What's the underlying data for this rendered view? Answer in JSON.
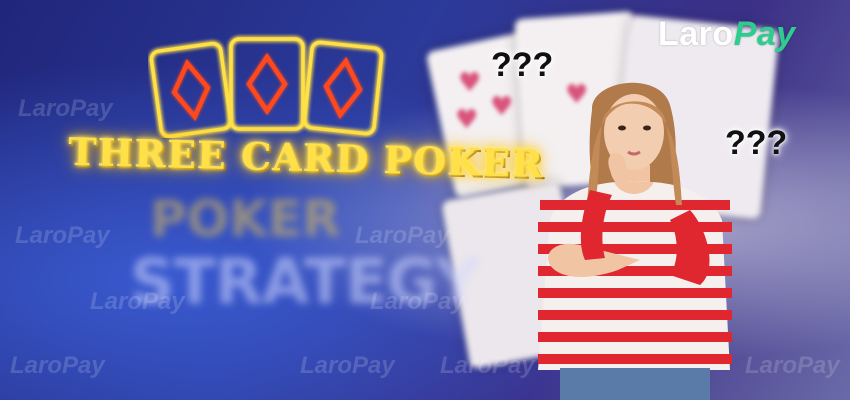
{
  "banner": {
    "title": "THREE CARD POKER",
    "background_text": {
      "top": "POKER",
      "bottom": "STRATEGY"
    },
    "question_marks": [
      "???",
      "???"
    ],
    "brand": {
      "name_part1": "Laro",
      "name_part2": "Pay",
      "watermark": "LaroPay"
    },
    "colors": {
      "neon_yellow": "#ffe046",
      "neon_red": "#ff4a1c",
      "brand_green": "#2ecc8e",
      "shirt_red": "#e0262f",
      "background_blue": "#2b3a9a"
    },
    "icons": [
      "diamond-icon",
      "diamond-icon",
      "diamond-icon"
    ]
  }
}
